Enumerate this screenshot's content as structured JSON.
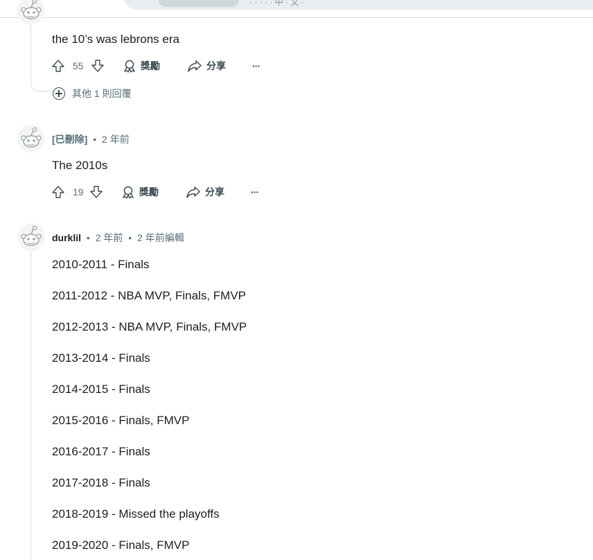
{
  "header": {
    "search_hint": "· · · · · 中 · 文 ·"
  },
  "comment_top": {
    "text": "the 10’s was lebrons era",
    "score": "55",
    "award_label": "獎勵",
    "share_label": "分享",
    "more_label": "···",
    "more_replies": "其他 1 則回覆"
  },
  "comment_deleted": {
    "author": "[已刪除]",
    "time": "2 年前",
    "text": "The 2010s",
    "score": "19",
    "award_label": "獎勵",
    "share_label": "分享",
    "more_label": "···"
  },
  "comment_durklil": {
    "author": "durklil",
    "time": "2 年前",
    "edited": "2 年前編輯",
    "lines": [
      "2010-2011 - Finals",
      "2011-2012 - NBA MVP, Finals, FMVP",
      "2012-2013 - NBA MVP, Finals, FMVP",
      "2013-2014 - Finals",
      "2014-2015 - Finals",
      "2015-2016 - Finals, FMVP",
      "2016-2017 - Finals",
      "2017-2018 - Finals",
      "2018-2019 - Missed the playoffs",
      "2019-2020 - Finals, FMVP"
    ]
  },
  "colors": {
    "text": "#1c1c1c",
    "meta": "#576f76",
    "thread_line": "#d7dadc",
    "action": "#3b4a50"
  },
  "icons": [
    "upvote-icon",
    "downvote-icon",
    "award-icon",
    "share-icon",
    "more-icon",
    "plus-circle-icon",
    "snoo-avatar-icon"
  ]
}
